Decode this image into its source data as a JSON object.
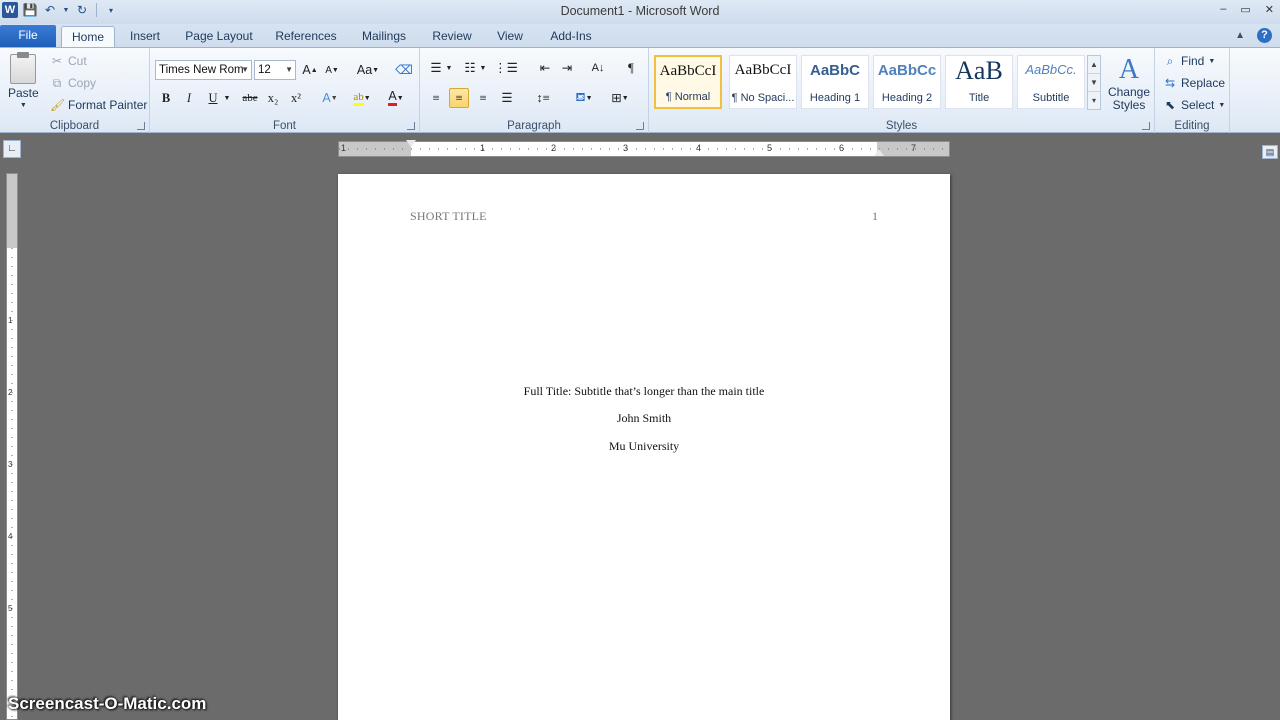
{
  "window": {
    "title": "Document1 - Microsoft Word",
    "app_icon": "W",
    "controls": [
      "–",
      "▭",
      "✕"
    ]
  },
  "quick_access": {
    "icons": [
      "save-icon",
      "undo-icon",
      "redo-icon",
      "customize-icon"
    ]
  },
  "tabs": {
    "file": "File",
    "items": [
      "Home",
      "Insert",
      "Page Layout",
      "References",
      "Mailings",
      "Review",
      "View",
      "Add-Ins"
    ],
    "active": "Home"
  },
  "ribbon": {
    "clipboard": {
      "label": "Clipboard",
      "paste": "Paste",
      "cut": "Cut",
      "copy": "Copy",
      "format_painter": "Format Painter"
    },
    "font": {
      "label": "Font",
      "font_name": "Times New Rom",
      "font_size": "12",
      "grow": "A",
      "shrink": "A",
      "change_case": "Aa",
      "bold": "B",
      "italic": "I",
      "underline": "U",
      "strikethrough": "abe",
      "subscript": "x₂",
      "superscript": "x²"
    },
    "paragraph": {
      "label": "Paragraph",
      "show_marks": "¶"
    },
    "styles": {
      "label": "Styles",
      "tiles": [
        {
          "sample": "AaBbCcI",
          "name": "¶ Normal",
          "selected": true
        },
        {
          "sample": "AaBbCcI",
          "name": "¶ No Spaci..."
        },
        {
          "sample": "AaBbC",
          "name": "Heading 1"
        },
        {
          "sample": "AaBbCc",
          "name": "Heading 2"
        },
        {
          "sample": "AaB",
          "name": "Title"
        },
        {
          "sample": "AaBbCc.",
          "name": "Subtitle"
        }
      ],
      "change_styles": "Change Styles"
    },
    "editing": {
      "label": "Editing",
      "find": "Find",
      "replace": "Replace",
      "select": "Select"
    }
  },
  "ruler": {
    "numbers": [
      "1",
      "1",
      "2",
      "3",
      "4",
      "5",
      "6",
      "7"
    ],
    "vertical_numbers": [
      "1",
      "2",
      "3",
      "4",
      "5"
    ]
  },
  "document": {
    "header_left": "SHORT TITLE",
    "header_right": "1",
    "lines": [
      "Full Title: Subtitle that’s longer than the main title",
      "John Smith",
      "Mu University"
    ]
  },
  "watermark": "Screencast-O-Matic.com",
  "colors": {
    "file_tab": "#1f5fb8",
    "selected_style": "#f0c040",
    "workspace": "#6b6b6b"
  }
}
